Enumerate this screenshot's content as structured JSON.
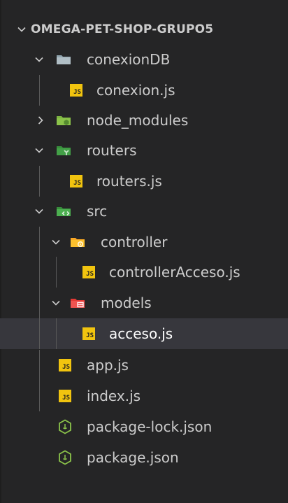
{
  "explorer": {
    "root": {
      "label": "OMEGA-PET-SHOP-GRUPO5",
      "expanded": true
    },
    "folders": {
      "conexiondb": {
        "label": "conexionDB",
        "icon": "folder-db-icon",
        "expanded": true
      },
      "node_modules": {
        "label": "node_modules",
        "icon": "folder-node-icon",
        "expanded": false
      },
      "routers": {
        "label": "routers",
        "icon": "folder-routes-icon",
        "expanded": true
      },
      "src": {
        "label": "src",
        "icon": "folder-src-icon",
        "expanded": true
      },
      "controller": {
        "label": "controller",
        "icon": "folder-controller-icon",
        "expanded": true
      },
      "models": {
        "label": "models",
        "icon": "folder-models-icon",
        "expanded": true
      }
    },
    "files": {
      "conexion_js": {
        "label": "conexion.js",
        "icon": "js-file-icon",
        "badge": "JS"
      },
      "routers_js": {
        "label": "routers.js",
        "icon": "js-file-icon",
        "badge": "JS"
      },
      "controlleracceso_js": {
        "label": "controllerAcceso.js",
        "icon": "js-file-icon",
        "badge": "JS"
      },
      "acceso_js": {
        "label": "acceso.js",
        "icon": "js-file-icon",
        "badge": "JS",
        "selected": true
      },
      "app_js": {
        "label": "app.js",
        "icon": "js-file-icon",
        "badge": "JS"
      },
      "index_js": {
        "label": "index.js",
        "icon": "js-file-icon",
        "badge": "JS"
      },
      "package_lock_json": {
        "label": "package-lock.json",
        "icon": "node-json-icon"
      },
      "package_json": {
        "label": "package.json",
        "icon": "node-json-icon"
      }
    },
    "colors": {
      "background": "#252526",
      "selected_row": "#37373d",
      "text": "#cccccc",
      "js_badge": "#f1c40f",
      "node_green": "#8bc34a",
      "folder_grey": "#90a4ae",
      "folder_routes": "#43a047",
      "folder_controller": "#fbc02d",
      "folder_models": "#ef5350"
    }
  }
}
